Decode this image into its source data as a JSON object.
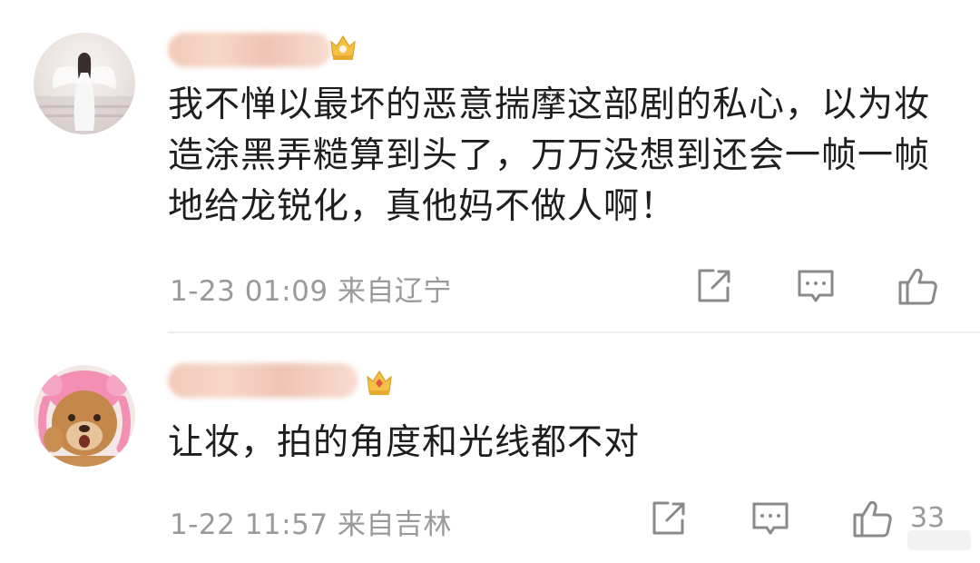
{
  "comments": [
    {
      "text": "我不惮以最坏的恶意揣摩这部剧的私心，以为妆造涂黑弄糙算到头了，万万没想到还会一帧一帧地给龙锐化，真他妈不做人啊！",
      "meta": "1-23 01:09 来自辽宁",
      "likes": ""
    },
    {
      "text": "让妆，拍的角度和光线都不对",
      "meta": "1-22 11:57 来自吉林",
      "likes": "33"
    }
  ],
  "icons": {
    "share": "share-icon",
    "comment": "comment-icon",
    "like": "thumbs-up-icon",
    "badge": "crown-badge-icon"
  },
  "colors": {
    "text": "#1e1e1e",
    "meta": "#9a9a9a",
    "icon": "#8a8a8a",
    "divider": "#ececec"
  }
}
